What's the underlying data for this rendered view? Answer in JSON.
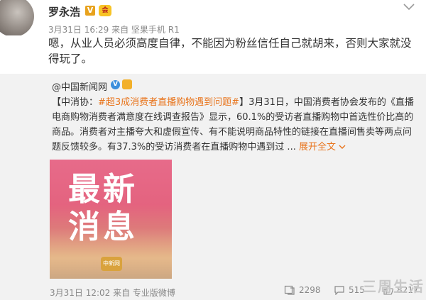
{
  "post": {
    "author": "罗永浩",
    "verified_badge": "V",
    "member_badge": "会",
    "meta": "3月31日 16:29 来自 坚果手机 R1",
    "text": "嗯，从业人员必须高度自律，不能因为粉丝信任自己就胡来，否则大家就没得玩了。"
  },
  "repost": {
    "author": "@中国新闻网",
    "verified_badge": "V",
    "text_prefix": "【中消协：",
    "tag": "#超3成消费者直播购物遇到问题#",
    "text_body": "】3月31日，中国消费者协会发布的《直播电商购物消费者满意度在线调查报告》显示，60.1%的受访者直播购物中首选性价比高的商品。消费者对主播夸大和虚假宣传、有不能说明商品特性的链接在直播间售卖等两点问题反馈较多。有37.3%的受访消费者在直播购物中遇到过 ...",
    "expand_label": "展开全文",
    "card": {
      "line1": "最新",
      "line2": "消息",
      "logo": "中新网"
    },
    "meta": "3月31日 12:02 来自 专业版微博",
    "stats": {
      "reposts": "2298",
      "comments": "515",
      "likes": "8217"
    }
  },
  "watermark": "三周生活"
}
